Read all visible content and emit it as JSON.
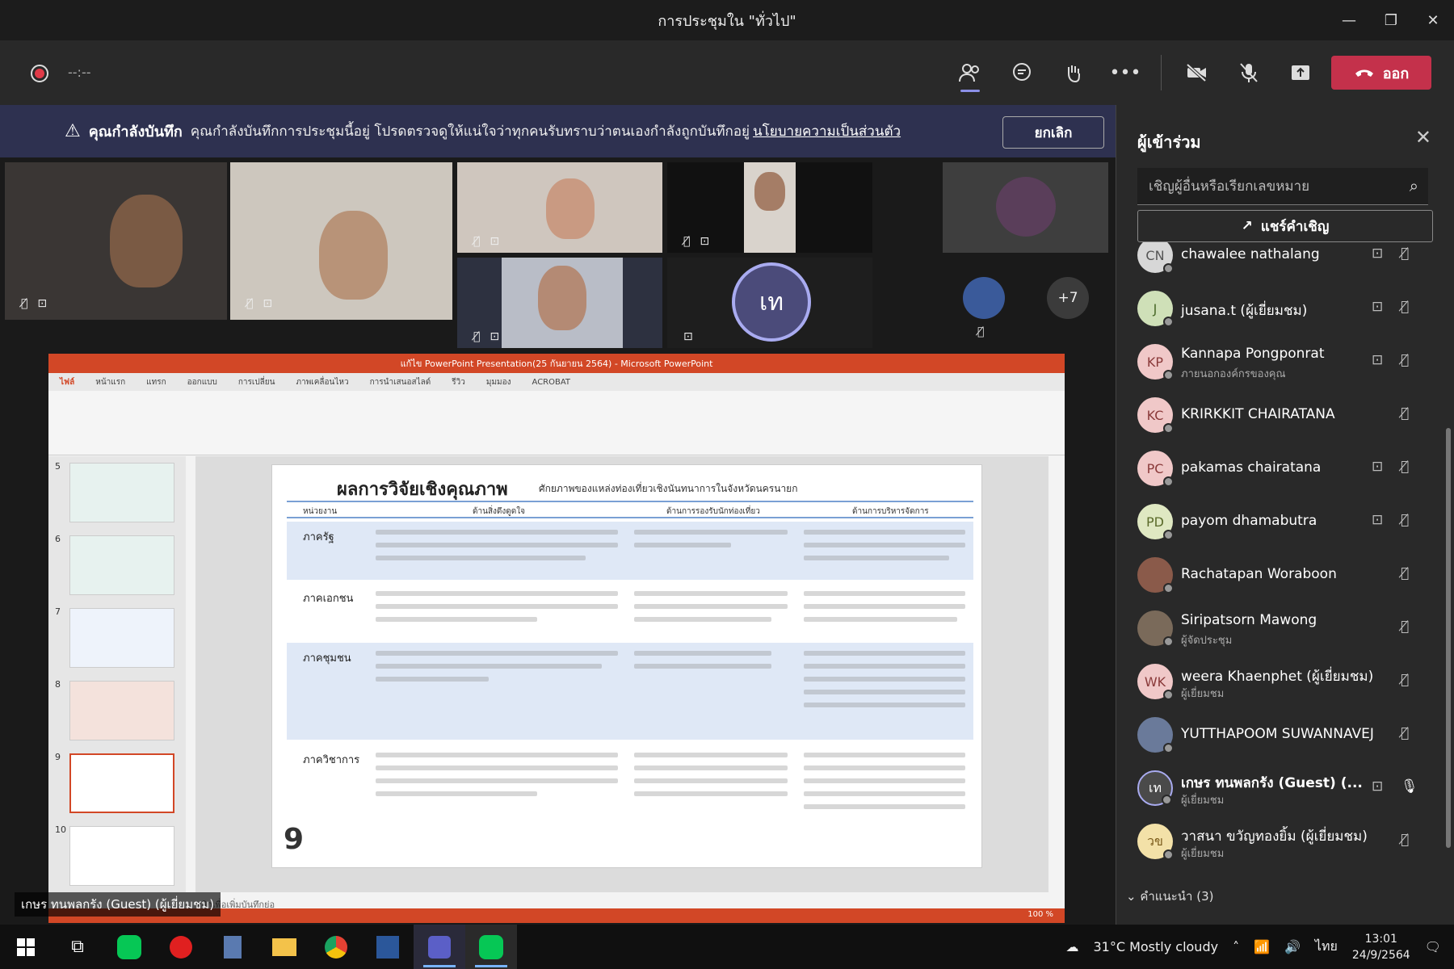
{
  "window": {
    "title": "การประชุมใน \"ทั่วไป\"",
    "min": "—",
    "max": "❐",
    "close": "✕"
  },
  "toolbar": {
    "timer": "--:--",
    "leave_label": "ออก"
  },
  "banner": {
    "title": "คุณกำลังบันทึก",
    "message": "คุณกำลังบันทึกการประชุมนี้อยู่ โปรดตรวจดูให้แน่ใจว่าทุกคนรับทราบว่าตนเองกำลังถูกบันทึกอยู่",
    "link": "นโยบายความเป็นส่วนตัว",
    "cancel": "ยกเลิก"
  },
  "stage": {
    "avatar_initial": "เท",
    "more_count": "+7",
    "presenter_name": "เกษร ทนพลกรัง (Guest) (ผู้เยี่ยมชม)"
  },
  "ppt": {
    "window_title": "แก้ไข PowerPoint Presentation(25 กันยายน 2564) - Microsoft PowerPoint",
    "tabs": [
      "ไฟล์",
      "หน้าแรก",
      "แทรก",
      "ออกแบบ",
      "การเปลี่ยน",
      "ภาพเคลื่อนไหว",
      "การนำเสนอสไลด์",
      "รีวิว",
      "มุมมอง",
      "ACROBAT"
    ],
    "slide_numbers": [
      "5",
      "6",
      "7",
      "8",
      "9",
      "10"
    ],
    "slide_title": "ผลการวิจัยเชิงคุณภาพ",
    "slide_subtitle": "ศักยภาพของแหล่งท่องเที่ยวเชิงนันทนาการในจังหวัดนครนายก",
    "headers": [
      "หน่วยงาน",
      "ด้านสิ่งดึงดูดใจ",
      "ด้านการรองรับนักท่องเที่ยว",
      "ด้านการบริหารจัดการ"
    ],
    "rows": [
      "ภาครัฐ",
      "ภาคเอกชน",
      "ภาคชุมชน",
      "ภาควิชาการ"
    ],
    "page_number": "9",
    "notes": "คลิกเพื่อเพิ่มบันทึกย่อ",
    "zoom": "100 %"
  },
  "panel": {
    "title": "ผู้เข้าร่วม",
    "search_placeholder": "เชิญผู้อื่นหรือเรียกเลขหมาย",
    "share": "แชร์คำเชิญ",
    "suggested": "คำแนะนำ (3)",
    "participants": [
      {
        "initials": "CN",
        "name": "chawalee nathalang",
        "sub": "",
        "color": "#d7d7d7"
      },
      {
        "initials": "J",
        "name": "jusana.t (ผู้เยี่ยมชม)",
        "sub": "",
        "color": "#cfe0b8"
      },
      {
        "initials": "KP",
        "name": "Kannapa Pongponrat",
        "sub": "ภายนอกองค์กรของคุณ",
        "color": "#f0c8c8"
      },
      {
        "initials": "KC",
        "name": "KRIRKKIT CHAIRATANA",
        "sub": "",
        "color": "#f0c8c8"
      },
      {
        "initials": "PC",
        "name": "pakamas chairatana",
        "sub": "",
        "color": "#f0c8c8"
      },
      {
        "initials": "PD",
        "name": "payom dhamabutra",
        "sub": "",
        "color": "#dfe8c2"
      },
      {
        "initials": "",
        "name": "Rachatapan Woraboon",
        "sub": "",
        "color": "#8a5a4a"
      },
      {
        "initials": "",
        "name": "Siripatsorn Mawong",
        "sub": "ผู้จัดประชุม",
        "color": "#7a6a5a"
      },
      {
        "initials": "WK",
        "name": "weera Khaenphet (ผู้เยี่ยมชม)",
        "sub": "ผู้เยี่ยมชม",
        "color": "#f0c8c8"
      },
      {
        "initials": "",
        "name": "YUTTHAPOOM SUWANNAVEJ",
        "sub": "",
        "color": "#6a7a9a"
      },
      {
        "initials": "เท",
        "name": "เกษร ทนพลกรัง (Guest) (...",
        "sub": "ผู้เยี่ยมชม",
        "color": "#4a4a4a"
      },
      {
        "initials": "วข",
        "name": "วาสนา ขวัญทองยิ้ม (ผู้เยี่ยมชม)",
        "sub": "ผู้เยี่ยมชม",
        "color": "#f3e1a8"
      }
    ]
  },
  "taskbar": {
    "weather": "31°C  Mostly cloudy",
    "lang": "ไทย",
    "time": "13:01",
    "date": "24/9/2564"
  }
}
